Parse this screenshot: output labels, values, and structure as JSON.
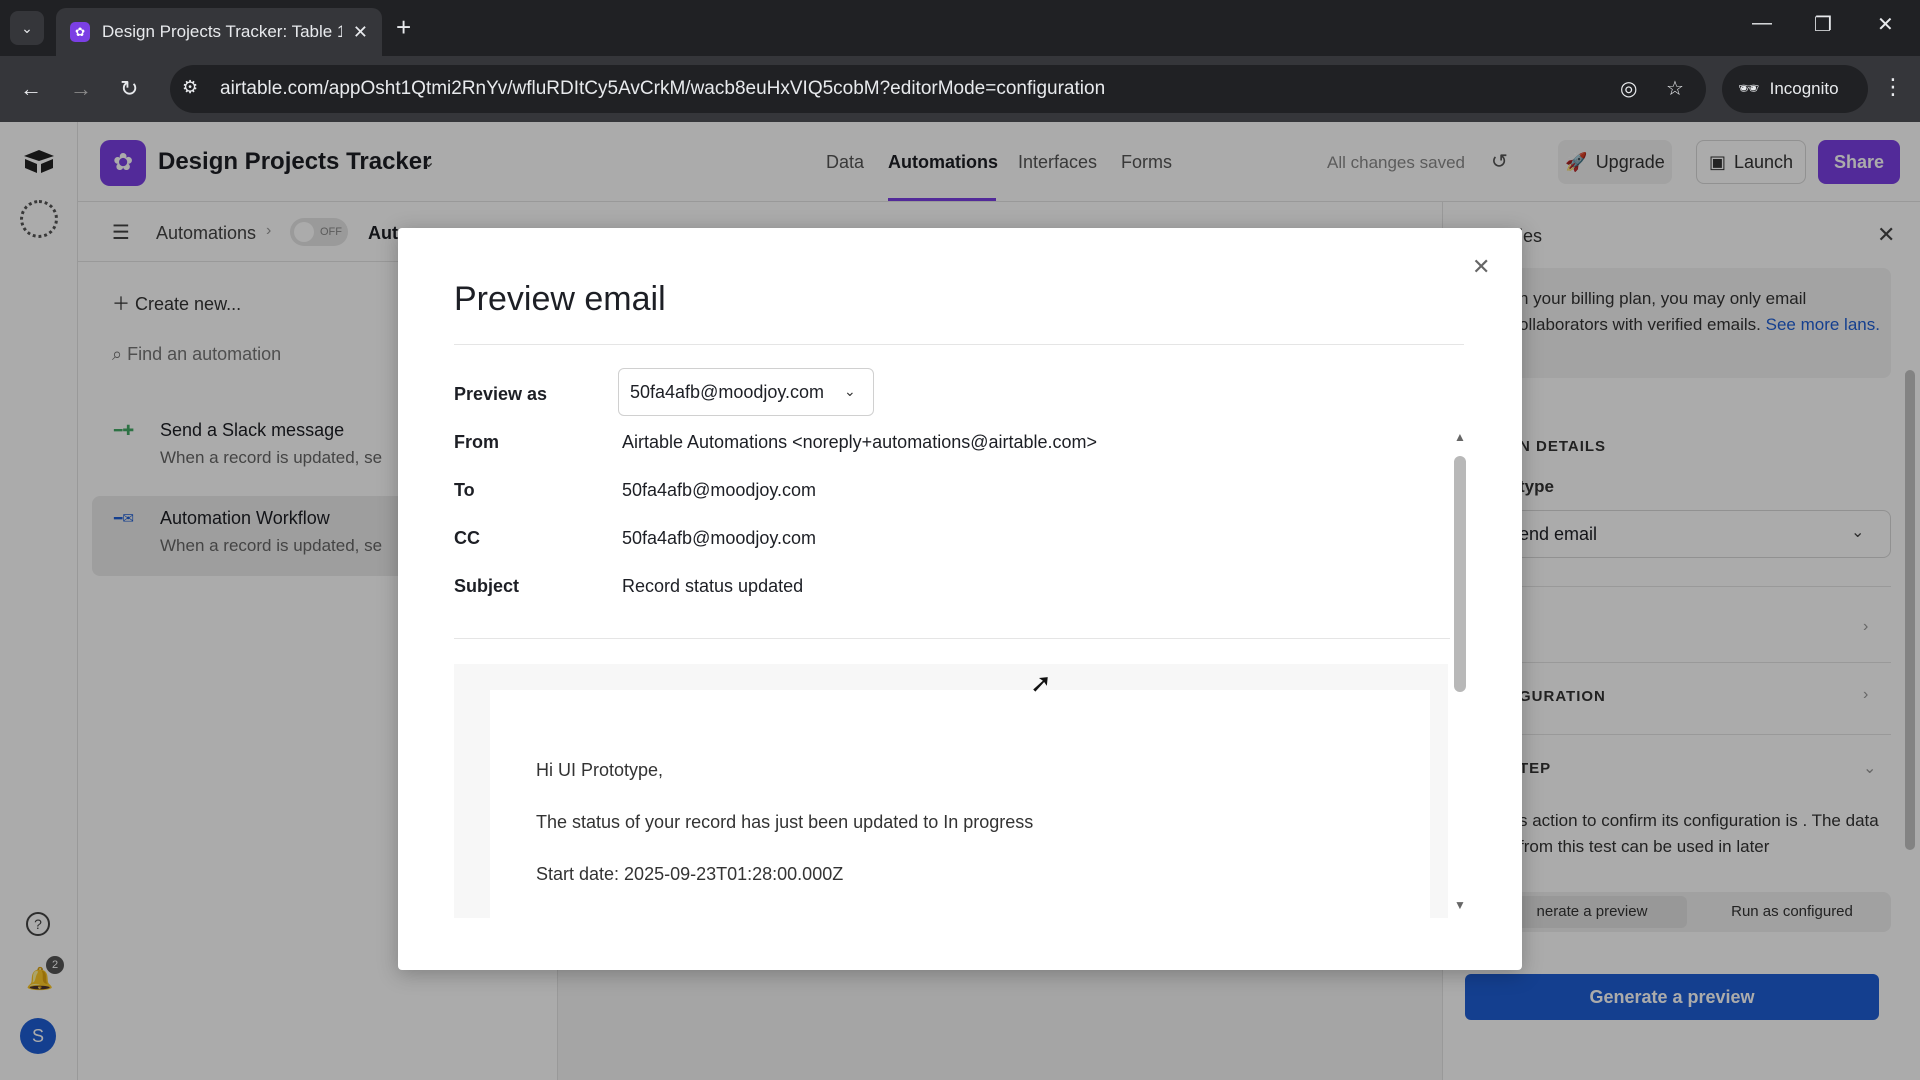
{
  "browser": {
    "tab_title": "Design Projects Tracker: Table 1",
    "url": "airtable.com/appOsht1Qtmi2RnYv/wfluRDItCy5AvCrkM/wacb8euHxVIQ5cobM?editorMode=configuration",
    "incognito_label": "Incognito",
    "icons": {
      "tab_search": "chevron-down-icon",
      "new_tab": "plus-icon",
      "back": "arrow-left-icon",
      "forward": "arrow-right-icon",
      "reload": "reload-icon"
    }
  },
  "app": {
    "base_name": "Design Projects Tracker",
    "nav_tabs": [
      "Data",
      "Automations",
      "Interfaces",
      "Forms"
    ],
    "active_tab": "Automations",
    "saved_status": "All changes saved",
    "upgrade_label": "Upgrade",
    "launch_label": "Launch",
    "share_label": "Share",
    "notification_count": "2",
    "avatar_initial": "S",
    "accent_color": "#7b3fe4"
  },
  "subbar": {
    "crumb": "Automations",
    "toggle_label": "OFF",
    "crumb_current": "Aut"
  },
  "left_panel": {
    "create_new": "Create new...",
    "find_placeholder": "Find an automation",
    "automations": [
      {
        "name": "Send a Slack message",
        "desc": "When a record is updated, se"
      },
      {
        "name": "Automation Workflow",
        "desc": "When a record is updated, se"
      }
    ]
  },
  "right_panel": {
    "title": "ies",
    "notice_text": "n your billing plan, you may only email ollaborators with verified emails.",
    "notice_link": "See more lans.",
    "section_details": "N DETAILS",
    "type_label": "type",
    "type_value": "end email",
    "section_configuration": "GURATION",
    "section_test": "TEP",
    "test_text": "s action to confirm its configuration is . The data from this test can be used in later",
    "seg_a": "nerate a preview",
    "seg_b": "Run as configured",
    "generate_button": "Generate a preview"
  },
  "modal": {
    "title": "Preview email",
    "preview_as_label": "Preview as",
    "preview_as_value": "50fa4afb@moodjoy.com",
    "fields": [
      {
        "label": "From",
        "value": "Airtable Automations <noreply+automations@airtable.com>"
      },
      {
        "label": "To",
        "value": "50fa4afb@moodjoy.com"
      },
      {
        "label": "CC",
        "value": "50fa4afb@moodjoy.com"
      },
      {
        "label": "Subject",
        "value": "Record status updated"
      }
    ],
    "body_lines": [
      "Hi UI Prototype,",
      "The status of your record has just been updated to In progress",
      "Start date: 2025-09-23T01:28:00.000Z"
    ]
  }
}
